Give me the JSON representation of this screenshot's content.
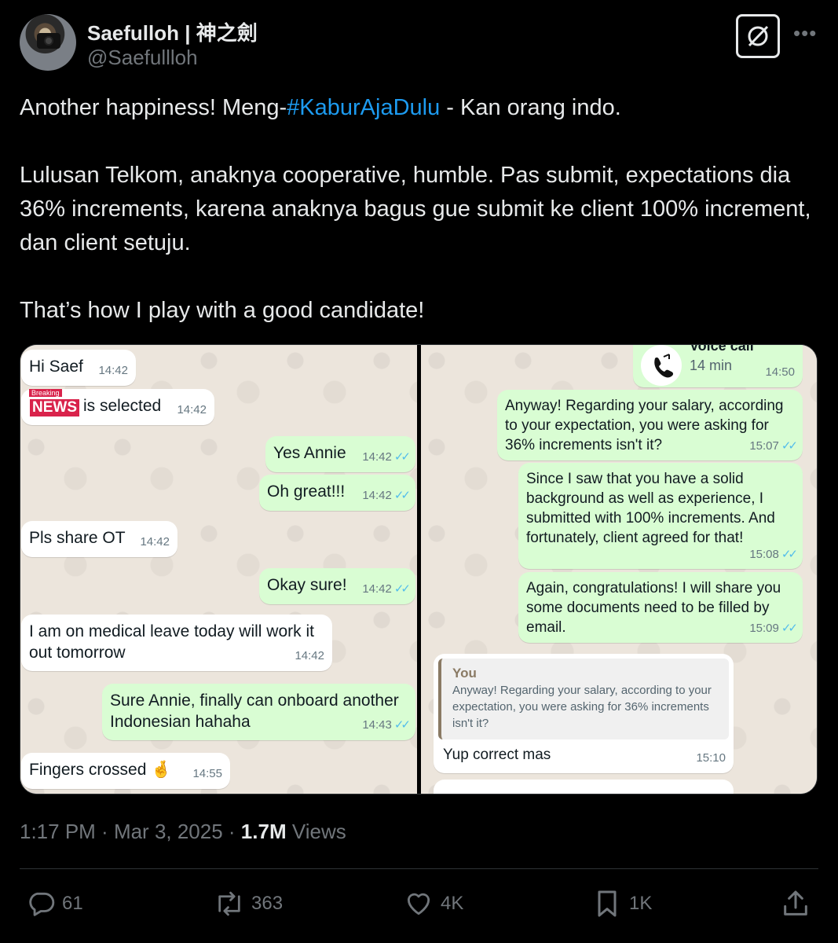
{
  "author": {
    "display_name": "Saefulloh | 神之劍",
    "handle": "@Saefullloh"
  },
  "tweet": {
    "line1_pre": "Another happiness! Meng-",
    "hashtag": "#KaburAjaDulu",
    "line1_post": " - Kan orang indo.",
    "para2": "Lulusan Telkom, anaknya cooperative, humble. Pas submit, expectations dia 36% increments, karena anaknya bagus gue submit ke client 100% increment, dan client setuju.",
    "para3": "That’s how I play with a good candidate!"
  },
  "left_chat": [
    {
      "text": "Hi Saef",
      "time": "14:42"
    },
    {
      "text": "is selected",
      "time": "14:42",
      "badge_top": "Breaking",
      "badge_main": "NEWS"
    },
    {
      "text": "Yes Annie",
      "time": "14:42"
    },
    {
      "text": "Oh great!!!",
      "time": "14:42"
    },
    {
      "text": "Pls share OT",
      "time": "14:42"
    },
    {
      "text": "Okay sure!",
      "time": "14:42"
    },
    {
      "text": "I am on medical leave today will work it out tomorrow",
      "time": "14:42"
    },
    {
      "text": "Sure Annie, finally can onboard another Indonesian hahaha",
      "time": "14:43"
    },
    {
      "text": "Fingers crossed 🤞",
      "time": "14:55"
    }
  ],
  "right_chat": {
    "call_label": "Voice call",
    "call_duration": "14 min",
    "call_time": "14:50",
    "messages": [
      {
        "text": "Anyway! Regarding your salary, according to your expectation, you were asking for 36% increments isn't it?",
        "time": "15:07"
      },
      {
        "text": "Since I saw that you have a solid background as well as experience, I submitted with 100% increments. And fortunately, client agreed for that!",
        "time": "15:08"
      },
      {
        "text": "Again, congratulations! I will share you some documents need to be filled by email.",
        "time": "15:09"
      }
    ],
    "reply": {
      "quote_author": "You",
      "quote_text": "Anyway! Regarding your salary, according to your expectation, you were asking for 36% increments isn't it?",
      "text": "Yup correct mas",
      "time": "15:10"
    }
  },
  "meta": {
    "time": "1:17 PM",
    "sep": " · ",
    "date": "Mar 3, 2025",
    "views_count": "1.7M",
    "views_label": " Views"
  },
  "stats": {
    "replies": "61",
    "reposts": "363",
    "likes": "4K",
    "bookmarks": "1K"
  },
  "colors": {
    "background": "#000000",
    "hashtag": "#1d9bf0",
    "outgoing_bubble": "#d9fdd3",
    "read_tick": "#53bdeb"
  }
}
